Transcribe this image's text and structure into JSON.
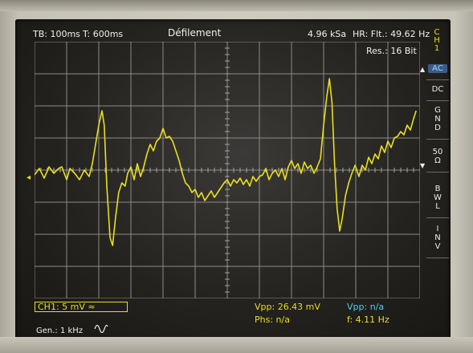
{
  "header": {
    "timebase": "TB: 100ms",
    "trigger_pos": "T: 600ms",
    "mode": "Défilement",
    "sample_rate": "4.96 kSa",
    "hr_filter": "HR: Flt.: 49.62 Hz",
    "resolution": "Res.: 16 Bit"
  },
  "side_menu": {
    "channel_tab": "C\nH\n1",
    "items": [
      {
        "label": "AC",
        "active": true
      },
      {
        "label": "DC",
        "active": false
      },
      {
        "label": "G\nN\nD",
        "active": false
      },
      {
        "label": "50\nΩ",
        "active": false
      },
      {
        "label": "B\nW\nL",
        "active": false
      },
      {
        "label": "I\nN\nV",
        "active": false
      }
    ]
  },
  "footer": {
    "ch1_setting": "CH1: 5 mV ≈",
    "vpp_ch1": "Vpp: 26.43 mV",
    "phase": "Phs: n/a",
    "vpp_cursor": "Vpp: n/a",
    "frequency": "f: 4.11 Hz",
    "generator": "Gen.: 1 kHz"
  },
  "chart_data": {
    "type": "line",
    "x_divisions": 12,
    "y_divisions": 8,
    "grid": true,
    "series": [
      {
        "color": "#e8df1e",
        "points": [
          [
            0,
            -0.15
          ],
          [
            0.15,
            0.05
          ],
          [
            0.3,
            -0.25
          ],
          [
            0.45,
            0.1
          ],
          [
            0.6,
            -0.1
          ],
          [
            0.75,
            0.05
          ],
          [
            0.85,
            0.1
          ],
          [
            1.0,
            -0.3
          ],
          [
            1.1,
            0.05
          ],
          [
            1.25,
            -0.1
          ],
          [
            1.4,
            -0.3
          ],
          [
            1.55,
            0.0
          ],
          [
            1.7,
            -0.2
          ],
          [
            1.8,
            0.2
          ],
          [
            1.9,
            0.8
          ],
          [
            2.0,
            1.4
          ],
          [
            2.1,
            1.85
          ],
          [
            2.17,
            1.4
          ],
          [
            2.25,
            -0.5
          ],
          [
            2.35,
            -2.1
          ],
          [
            2.43,
            -2.35
          ],
          [
            2.52,
            -1.5
          ],
          [
            2.62,
            -0.7
          ],
          [
            2.72,
            -0.4
          ],
          [
            2.82,
            -0.5
          ],
          [
            2.9,
            -0.1
          ],
          [
            3.0,
            0.1
          ],
          [
            3.1,
            -0.3
          ],
          [
            3.2,
            0.2
          ],
          [
            3.3,
            -0.2
          ],
          [
            3.4,
            0.1
          ],
          [
            3.5,
            0.5
          ],
          [
            3.6,
            0.8
          ],
          [
            3.7,
            0.6
          ],
          [
            3.8,
            0.9
          ],
          [
            3.9,
            1.0
          ],
          [
            4.0,
            1.3
          ],
          [
            4.1,
            1.0
          ],
          [
            4.2,
            1.05
          ],
          [
            4.3,
            0.9
          ],
          [
            4.4,
            0.6
          ],
          [
            4.5,
            0.3
          ],
          [
            4.6,
            -0.1
          ],
          [
            4.7,
            -0.4
          ],
          [
            4.8,
            -0.5
          ],
          [
            4.9,
            -0.7
          ],
          [
            5.0,
            -0.6
          ],
          [
            5.1,
            -0.85
          ],
          [
            5.2,
            -0.7
          ],
          [
            5.3,
            -0.95
          ],
          [
            5.4,
            -0.8
          ],
          [
            5.5,
            -0.65
          ],
          [
            5.6,
            -0.85
          ],
          [
            5.7,
            -0.7
          ],
          [
            5.8,
            -0.55
          ],
          [
            5.9,
            -0.4
          ],
          [
            6.0,
            -0.3
          ],
          [
            6.1,
            -0.5
          ],
          [
            6.2,
            -0.3
          ],
          [
            6.3,
            -0.4
          ],
          [
            6.4,
            -0.25
          ],
          [
            6.5,
            -0.45
          ],
          [
            6.6,
            -0.3
          ],
          [
            6.7,
            -0.5
          ],
          [
            6.8,
            -0.2
          ],
          [
            6.9,
            -0.35
          ],
          [
            7.0,
            -0.2
          ],
          [
            7.1,
            -0.15
          ],
          [
            7.2,
            0.05
          ],
          [
            7.3,
            -0.3
          ],
          [
            7.4,
            -0.1
          ],
          [
            7.5,
            0.0
          ],
          [
            7.6,
            -0.2
          ],
          [
            7.7,
            0.05
          ],
          [
            7.8,
            -0.3
          ],
          [
            7.9,
            0.1
          ],
          [
            8.0,
            0.3
          ],
          [
            8.1,
            0.05
          ],
          [
            8.2,
            0.2
          ],
          [
            8.3,
            -0.1
          ],
          [
            8.4,
            0.25
          ],
          [
            8.5,
            0.05
          ],
          [
            8.6,
            0.15
          ],
          [
            8.7,
            -0.1
          ],
          [
            8.8,
            0.1
          ],
          [
            8.9,
            0.35
          ],
          [
            9.0,
            1.4
          ],
          [
            9.1,
            2.3
          ],
          [
            9.18,
            2.85
          ],
          [
            9.26,
            2.1
          ],
          [
            9.34,
            0.2
          ],
          [
            9.42,
            -1.2
          ],
          [
            9.5,
            -1.9
          ],
          [
            9.58,
            -1.5
          ],
          [
            9.68,
            -0.8
          ],
          [
            9.78,
            -0.4
          ],
          [
            9.88,
            -0.1
          ],
          [
            9.98,
            0.15
          ],
          [
            10.1,
            -0.2
          ],
          [
            10.2,
            0.15
          ],
          [
            10.3,
            0.0
          ],
          [
            10.4,
            0.4
          ],
          [
            10.5,
            0.2
          ],
          [
            10.6,
            0.5
          ],
          [
            10.7,
            0.35
          ],
          [
            10.8,
            0.75
          ],
          [
            10.9,
            0.55
          ],
          [
            11.0,
            0.9
          ],
          [
            11.1,
            0.7
          ],
          [
            11.2,
            1.0
          ],
          [
            11.3,
            1.05
          ],
          [
            11.4,
            1.2
          ],
          [
            11.5,
            1.1
          ],
          [
            11.6,
            1.4
          ],
          [
            11.7,
            1.25
          ],
          [
            11.8,
            1.6
          ],
          [
            11.88,
            1.85
          ]
        ]
      }
    ]
  }
}
